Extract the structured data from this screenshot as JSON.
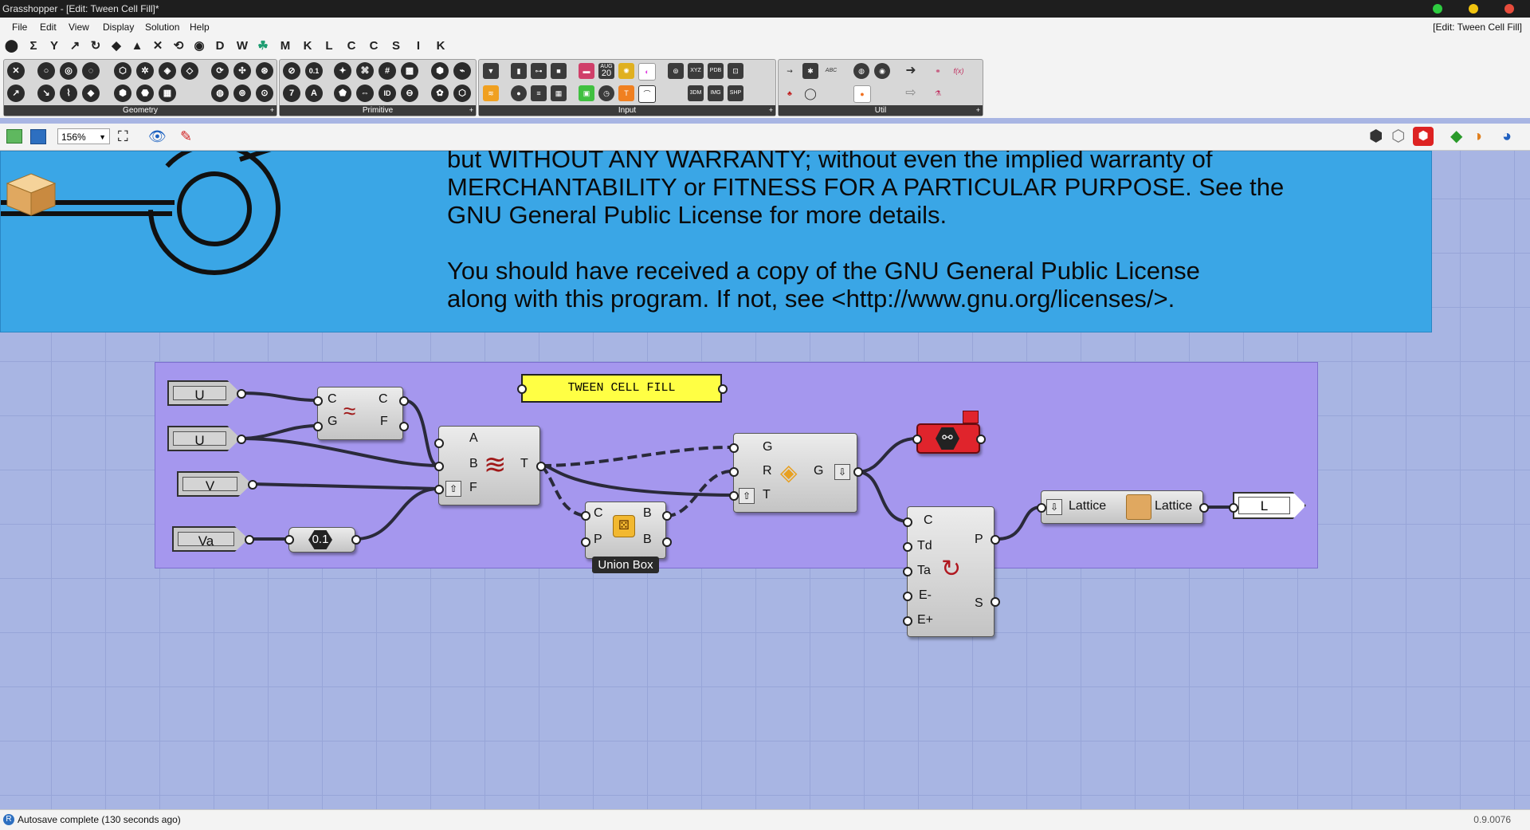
{
  "window": {
    "title": "Grasshopper - [Edit: Tween Cell Fill]*",
    "dots": [
      "#2ecc40",
      "#f1c40f",
      "#e74c3c"
    ]
  },
  "menu": {
    "items": [
      "File",
      "Edit",
      "View",
      "Display",
      "Solution",
      "Help"
    ],
    "document_label": "[Edit: Tween Cell Fill]"
  },
  "tabs": [
    "Σ",
    "Y",
    "D",
    "W",
    "M",
    "K",
    "L",
    "C",
    "C",
    "S",
    "I",
    "K"
  ],
  "toolbar_groups": {
    "geometry": "Geometry",
    "primitive": "Primitive",
    "input": "Input",
    "util": "Util"
  },
  "primitive_labels": {
    "a": "0.1",
    "b": "7",
    "c": "A",
    "d": "ID"
  },
  "input_labels": {
    "aug": "AUG",
    "day": "20",
    "xyz": "XYZ",
    "pdb": "PDB",
    "img": "IMG",
    "shp": "SHP",
    "3dm": "3DM"
  },
  "util_labels": {
    "abc": "ABC",
    "fx": "f(x)"
  },
  "canvas_toolbar": {
    "zoom": "156%"
  },
  "license_text": "but WITHOUT ANY WARRANTY; without even the implied warranty of\nMERCHANTABILITY or FITNESS FOR A PARTICULAR PURPOSE.  See the\nGNU General Public License for more details.\n\nYou should have received a copy of the GNU General Public License\nalong with this program.  If not, see <http://www.gnu.org/licenses/>.",
  "params": {
    "u1": "U",
    "u2": "U",
    "v": "V",
    "va": "Va",
    "slider": "0.1",
    "l": "L"
  },
  "panel_text": "TWEEN CELL FILL",
  "comp1": {
    "in": [
      "C",
      "G"
    ],
    "out": [
      "C",
      "F"
    ]
  },
  "comp2": {
    "in": [
      "A",
      "B",
      "F"
    ],
    "out": [
      "T"
    ]
  },
  "union_box": {
    "in": [
      "C",
      "P"
    ],
    "out": [
      "B",
      "B"
    ],
    "label": "Union Box"
  },
  "comp4": {
    "in": [
      "G",
      "R",
      "T"
    ],
    "out": [
      "G"
    ]
  },
  "comp5": {
    "in": [
      "C",
      "Td",
      "Ta",
      "E-",
      "E+"
    ],
    "out": [
      "P",
      "S"
    ]
  },
  "lattice": {
    "in": "Lattice",
    "out": "Lattice"
  },
  "status": {
    "text": "Autosave complete (130 seconds ago)",
    "version": "0.9.0076"
  }
}
